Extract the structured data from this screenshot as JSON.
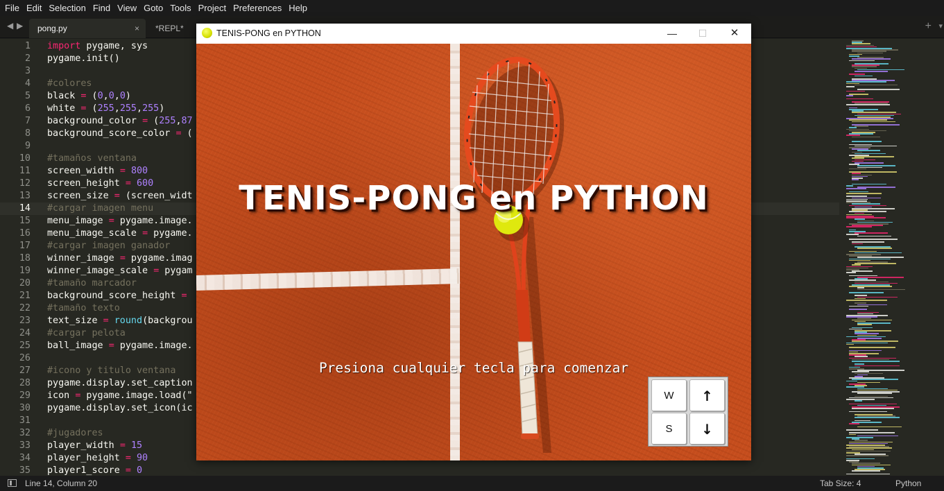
{
  "menu": [
    "File",
    "Edit",
    "Selection",
    "Find",
    "View",
    "Goto",
    "Tools",
    "Project",
    "Preferences",
    "Help"
  ],
  "tabs": {
    "active": "pong.py",
    "active_close": "×",
    "second": "*REPL* [pyth",
    "plus": "+",
    "overflow": "▾"
  },
  "nav_icons": [
    "chevron-left-icon",
    "chevron-right-icon"
  ],
  "editor": {
    "current_line": 14,
    "lines": [
      [
        [
          "kw",
          "import"
        ],
        [
          "",
          " pygame, sys"
        ]
      ],
      [
        [
          "",
          "pygame.init()"
        ]
      ],
      [],
      [
        [
          "cm",
          "#colores"
        ]
      ],
      [
        [
          "",
          "black "
        ],
        [
          "op",
          "="
        ],
        [
          "",
          " ("
        ],
        [
          "num",
          "0"
        ],
        [
          "",
          ","
        ],
        [
          "num",
          "0"
        ],
        [
          "",
          ","
        ],
        [
          "num",
          "0"
        ],
        [
          "",
          ")"
        ]
      ],
      [
        [
          "",
          "white "
        ],
        [
          "op",
          "="
        ],
        [
          "",
          " ("
        ],
        [
          "num",
          "255"
        ],
        [
          "",
          ","
        ],
        [
          "num",
          "255"
        ],
        [
          "",
          ","
        ],
        [
          "num",
          "255"
        ],
        [
          "",
          ")"
        ]
      ],
      [
        [
          "",
          "background_color "
        ],
        [
          "op",
          "="
        ],
        [
          "",
          " ("
        ],
        [
          "num",
          "255"
        ],
        [
          "",
          ","
        ],
        [
          "num",
          "87"
        ]
      ],
      [
        [
          "",
          "background_score_color "
        ],
        [
          "op",
          "="
        ],
        [
          "",
          " ("
        ]
      ],
      [],
      [
        [
          "cm",
          "#tamaños ventana"
        ]
      ],
      [
        [
          "",
          "screen_width "
        ],
        [
          "op",
          "="
        ],
        [
          "",
          " "
        ],
        [
          "num",
          "800"
        ]
      ],
      [
        [
          "",
          "screen_height "
        ],
        [
          "op",
          "="
        ],
        [
          "",
          " "
        ],
        [
          "num",
          "600"
        ]
      ],
      [
        [
          "",
          "screen_size "
        ],
        [
          "op",
          "="
        ],
        [
          "",
          " (screen_widt"
        ]
      ],
      [
        [
          "cm",
          "#cargar imagen menu"
        ]
      ],
      [
        [
          "",
          "menu_image "
        ],
        [
          "op",
          "="
        ],
        [
          "",
          " pygame.image."
        ]
      ],
      [
        [
          "",
          "menu_image_scale "
        ],
        [
          "op",
          "="
        ],
        [
          "",
          " pygame."
        ]
      ],
      [
        [
          "cm",
          "#cargar imagen ganador"
        ]
      ],
      [
        [
          "",
          "winner_image "
        ],
        [
          "op",
          "="
        ],
        [
          "",
          " pygame.imag"
        ]
      ],
      [
        [
          "",
          "winner_image_scale "
        ],
        [
          "op",
          "="
        ],
        [
          "",
          " pygam"
        ]
      ],
      [
        [
          "cm",
          "#tamaño marcador"
        ]
      ],
      [
        [
          "",
          "background_score_height "
        ],
        [
          "op",
          "="
        ],
        [
          "",
          " "
        ]
      ],
      [
        [
          "cm",
          "#tamaño texto"
        ]
      ],
      [
        [
          "",
          "text_size "
        ],
        [
          "op",
          "="
        ],
        [
          "",
          " "
        ],
        [
          "fn",
          "round"
        ],
        [
          "",
          "(backgrou"
        ]
      ],
      [
        [
          "cm",
          "#cargar pelota"
        ]
      ],
      [
        [
          "",
          "ball_image "
        ],
        [
          "op",
          "="
        ],
        [
          "",
          " pygame.image."
        ]
      ],
      [],
      [
        [
          "cm",
          "#icono y titulo ventana"
        ]
      ],
      [
        [
          "",
          "pygame.display.set_caption"
        ]
      ],
      [
        [
          "",
          "icon "
        ],
        [
          "op",
          "="
        ],
        [
          "",
          " pygame.image.load(\""
        ]
      ],
      [
        [
          "",
          "pygame.display.set_icon(ic"
        ]
      ],
      [],
      [
        [
          "cm",
          "#jugadores"
        ]
      ],
      [
        [
          "",
          "player_width "
        ],
        [
          "op",
          "="
        ],
        [
          "",
          " "
        ],
        [
          "num",
          "15"
        ]
      ],
      [
        [
          "",
          "player_height "
        ],
        [
          "op",
          "="
        ],
        [
          "",
          " "
        ],
        [
          "num",
          "90"
        ]
      ],
      [
        [
          "",
          "player1_score "
        ],
        [
          "op",
          "="
        ],
        [
          "",
          " "
        ],
        [
          "num",
          "0"
        ]
      ]
    ]
  },
  "game_window": {
    "title": "TENIS-PONG en PYTHON",
    "minimize": "—",
    "maximize": "☐",
    "close": "✕",
    "heading": "TENIS-PONG en PYTHON",
    "prompt": "Presiona cualquier tecla para comenzar",
    "keys": {
      "w": "W",
      "s": "S",
      "up": "↑",
      "down": "↓"
    }
  },
  "status": {
    "position": "Line 14, Column 20",
    "tab_size": "Tab Size: 4",
    "language": "Python"
  },
  "colors": {
    "clay": "#c54d1d",
    "keyword": "#f92672",
    "number": "#ae81ff",
    "comment": "#75715e",
    "builtin": "#66d9ef",
    "editor_bg": "#272822"
  }
}
